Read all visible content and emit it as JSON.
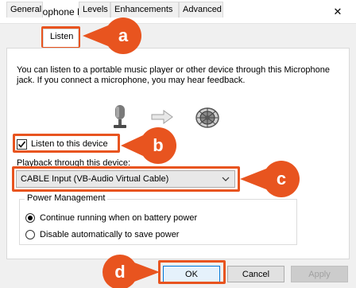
{
  "window": {
    "title": "Microphone Properties",
    "close_symbol": "✕"
  },
  "tabs": [
    {
      "label": "General",
      "active": false
    },
    {
      "label": "Listen",
      "active": true
    },
    {
      "label": "Levels",
      "active": false
    },
    {
      "label": "Enhancements",
      "active": false
    },
    {
      "label": "Advanced",
      "active": false
    }
  ],
  "listen": {
    "description": "You can listen to a portable music player or other device through this Microphone jack.  If you connect a microphone, you may hear feedback.",
    "checkbox_label": "Listen to this device",
    "checkbox_checked": true,
    "playback_label": "Playback through this device:",
    "playback_value": "CABLE Input (VB-Audio Virtual Cable)"
  },
  "power": {
    "group_label": "Power Management",
    "options": [
      {
        "label": "Continue running when on battery power",
        "selected": true
      },
      {
        "label": "Disable automatically to save power",
        "selected": false
      }
    ]
  },
  "buttons": {
    "ok": "OK",
    "cancel": "Cancel",
    "apply": "Apply"
  },
  "callouts": [
    "a",
    "b",
    "c",
    "d"
  ],
  "colors": {
    "callout": "#e8541f",
    "highlight": "#e8541f",
    "focus": "#0078d7"
  },
  "icons": {
    "title": "microphone-icon",
    "device": "microphone-icon",
    "arrow": "arrow-right-icon",
    "speaker": "speaker-icon"
  }
}
